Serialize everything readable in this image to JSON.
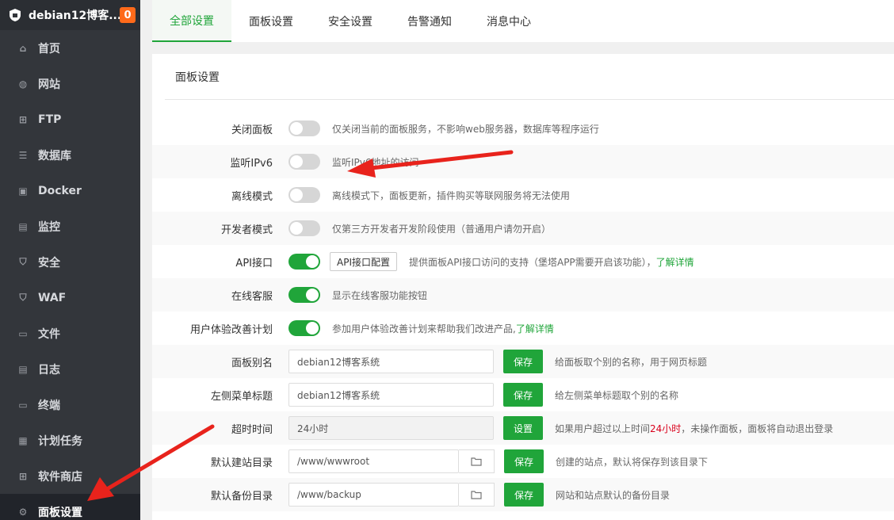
{
  "brand": {
    "title": "debian12博客...",
    "badge": "0"
  },
  "sidebar": {
    "items": [
      {
        "label": "首页",
        "icon": "home-icon",
        "glyph": "⌂"
      },
      {
        "label": "网站",
        "icon": "globe-icon",
        "glyph": "◍"
      },
      {
        "label": "FTP",
        "icon": "ftp-icon",
        "glyph": "⊞"
      },
      {
        "label": "数据库",
        "icon": "database-icon",
        "glyph": "☰"
      },
      {
        "label": "Docker",
        "icon": "docker-icon",
        "glyph": "▣"
      },
      {
        "label": "监控",
        "icon": "monitor-icon",
        "glyph": "▤"
      },
      {
        "label": "安全",
        "icon": "shield-icon",
        "glyph": "⛉"
      },
      {
        "label": "WAF",
        "icon": "waf-icon",
        "glyph": "⛉"
      },
      {
        "label": "文件",
        "icon": "folder-icon",
        "glyph": "▭"
      },
      {
        "label": "日志",
        "icon": "log-icon",
        "glyph": "▤"
      },
      {
        "label": "终端",
        "icon": "terminal-icon",
        "glyph": "▭"
      },
      {
        "label": "计划任务",
        "icon": "schedule-icon",
        "glyph": "▦"
      },
      {
        "label": "软件商店",
        "icon": "store-icon",
        "glyph": "⊞"
      },
      {
        "label": "面板设置",
        "icon": "gear-icon",
        "glyph": "⚙"
      }
    ]
  },
  "tabs": [
    "全部设置",
    "面板设置",
    "安全设置",
    "告警通知",
    "消息中心"
  ],
  "panel": {
    "title": "面板设置",
    "toggles": [
      {
        "label": "关闭面板",
        "on": false,
        "desc": "仅关闭当前的面板服务，不影响web服务器，数据库等程序运行"
      },
      {
        "label": "监听IPv6",
        "on": false,
        "desc": "监听IPv6地址的访问"
      },
      {
        "label": "离线模式",
        "on": false,
        "desc": "离线模式下，面板更新，插件购买等联网服务将无法使用"
      },
      {
        "label": "开发者模式",
        "on": false,
        "desc": "仅第三方开发者开发阶段使用（普通用户请勿开启）"
      },
      {
        "label": "API接口",
        "on": true,
        "button": "API接口配置",
        "desc": "提供面板API接口访问的支持（堡塔APP需要开启该功能），",
        "link": "了解详情"
      },
      {
        "label": "在线客服",
        "on": true,
        "desc": "显示在线客服功能按钮"
      },
      {
        "label": "用户体验改善计划",
        "on": true,
        "desc": "参加用户体验改善计划来帮助我们改进产品,",
        "link": "了解详情"
      }
    ],
    "fields": [
      {
        "label": "面板别名",
        "value": "debian12博客系统",
        "button": "保存",
        "desc": "给面板取个别的名称，用于网页标题"
      },
      {
        "label": "左侧菜单标题",
        "value": "debian12博客系统",
        "button": "保存",
        "desc": "给左侧菜单标题取个别的名称"
      },
      {
        "label": "超时时间",
        "value": "24小时",
        "button": "设置",
        "desc_pre": "如果用户超过以上时间",
        "desc_red": "24小时",
        "desc_post": "，未操作面板，面板将自动退出登录"
      },
      {
        "label": "默认建站目录",
        "value": "/www/wwwroot",
        "button": "保存",
        "desc": "创建的站点，默认将保存到该目录下"
      },
      {
        "label": "默认备份目录",
        "value": "/www/backup",
        "button": "保存",
        "desc": "网站和站点默认的备份目录"
      }
    ]
  }
}
